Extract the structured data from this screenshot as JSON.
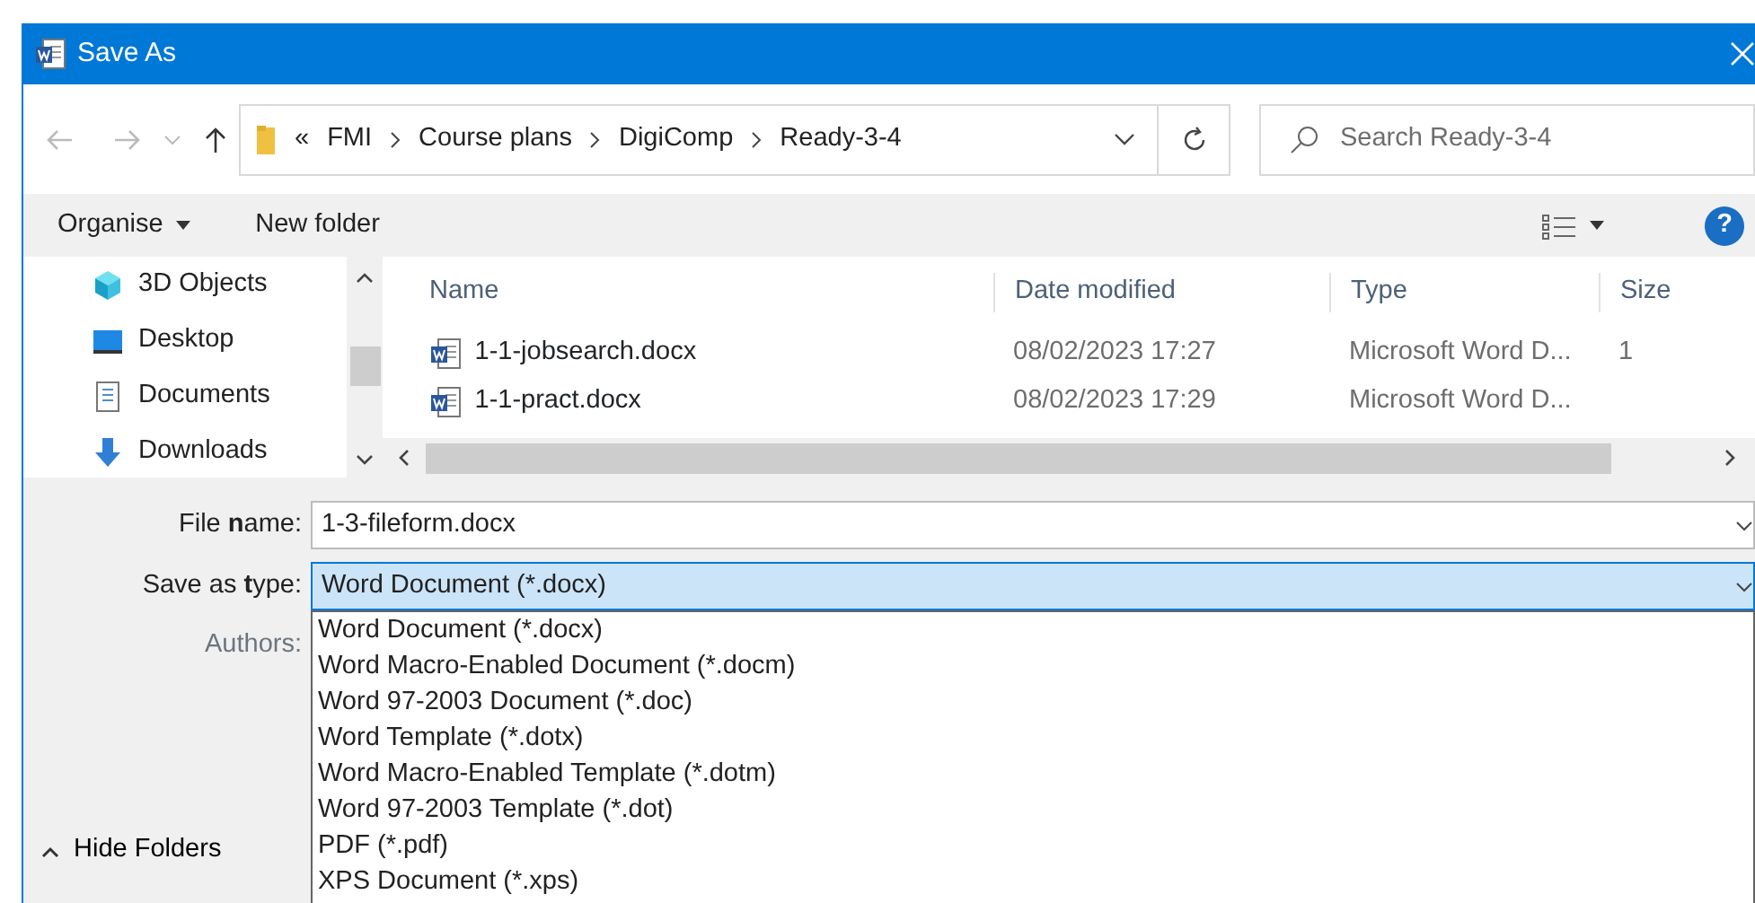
{
  "window": {
    "title": "Save As"
  },
  "address": {
    "breadcrumb": [
      "«",
      "FMI",
      "Course plans",
      "DigiComp",
      "Ready-3-4"
    ]
  },
  "search": {
    "placeholder": "Search Ready-3-4"
  },
  "toolbar": {
    "organise": "Organise",
    "new_folder": "New folder",
    "help": "?"
  },
  "sidebar": {
    "items": [
      {
        "label": "3D Objects",
        "kind": "cube"
      },
      {
        "label": "Desktop",
        "kind": "desktop"
      },
      {
        "label": "Documents",
        "kind": "documents"
      },
      {
        "label": "Downloads",
        "kind": "download"
      }
    ]
  },
  "table": {
    "columns": [
      "Name",
      "Date modified",
      "Type",
      "Size"
    ],
    "rows": [
      {
        "name": "1-1-jobsearch.docx",
        "date": "08/02/2023 17:27",
        "type": "Microsoft Word D...",
        "size": "1"
      },
      {
        "name": "1-1-pract.docx",
        "date": "08/02/2023 17:29",
        "type": "Microsoft Word D..."
      }
    ]
  },
  "form": {
    "file_name_label": "File **n**ame:",
    "file_name": "1-3-fileform.docx",
    "save_type_label": "Save as **t**ype:",
    "save_type": "Word Document (*.docx)",
    "authors_label": "Authors:"
  },
  "type_options": [
    {
      "label": "Word Document (*.docx)",
      "selected": false
    },
    {
      "label": "Word Macro-Enabled Document (*.docm)",
      "selected": false
    },
    {
      "label": "Word 97-2003 Document (*.doc)",
      "selected": false
    },
    {
      "label": "Word Template (*.dotx)",
      "selected": false
    },
    {
      "label": "Word Macro-Enabled Template (*.dotm)",
      "selected": false
    },
    {
      "label": "Word 97-2003 Template (*.dot)",
      "selected": false
    },
    {
      "label": "PDF (*.pdf)",
      "selected": false
    },
    {
      "label": "XPS Document (*.xps)",
      "selected": false
    }
  ],
  "hide_folders": "Hide Folders"
}
